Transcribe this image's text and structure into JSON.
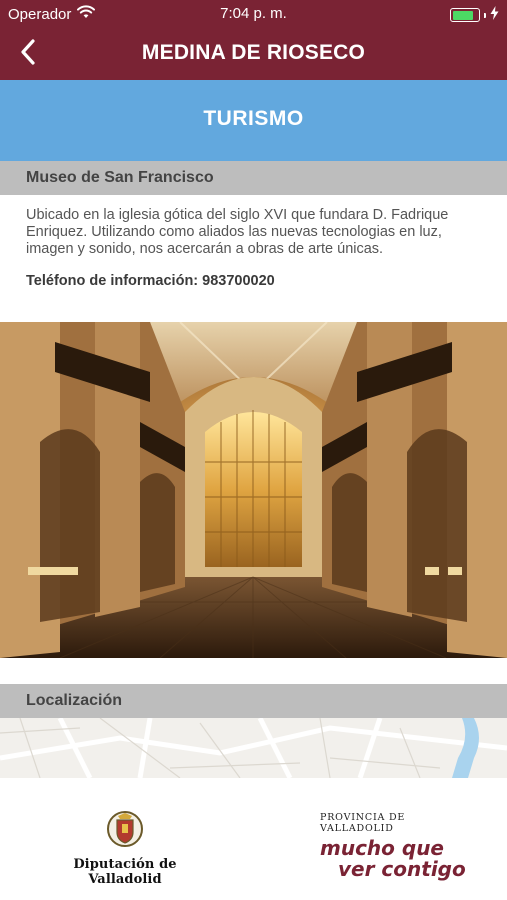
{
  "status_bar": {
    "carrier": "Operador",
    "time": "7:04 p. m.",
    "battery_level": 0.85,
    "colors": {
      "background": "#7a2334",
      "battery": "#4cd964"
    }
  },
  "nav": {
    "title": "MEDINA DE RIOSECO",
    "back_icon": "chevron-left-icon"
  },
  "section": {
    "title": "TURISMO",
    "color": "#62a8de"
  },
  "place": {
    "name": "Museo de San Francisco",
    "description": "Ubicado en la iglesia gótica del siglo XVI que fundara D. Fadrique Enriquez. Utilizando como aliados las nuevas tecnologias en luz, imagen y sonido, nos acercarán a obras de arte únicas.",
    "phone_label": "Teléfono de información: 983700020"
  },
  "location": {
    "header": "Localización"
  },
  "footer": {
    "diputacion": "Diputación de Valladolid",
    "provincia": "PROVINCIA DE VALLADOLID",
    "slogan_line1": "mucho que",
    "slogan_line2": "ver contigo",
    "brand_color": "#7a2334"
  }
}
